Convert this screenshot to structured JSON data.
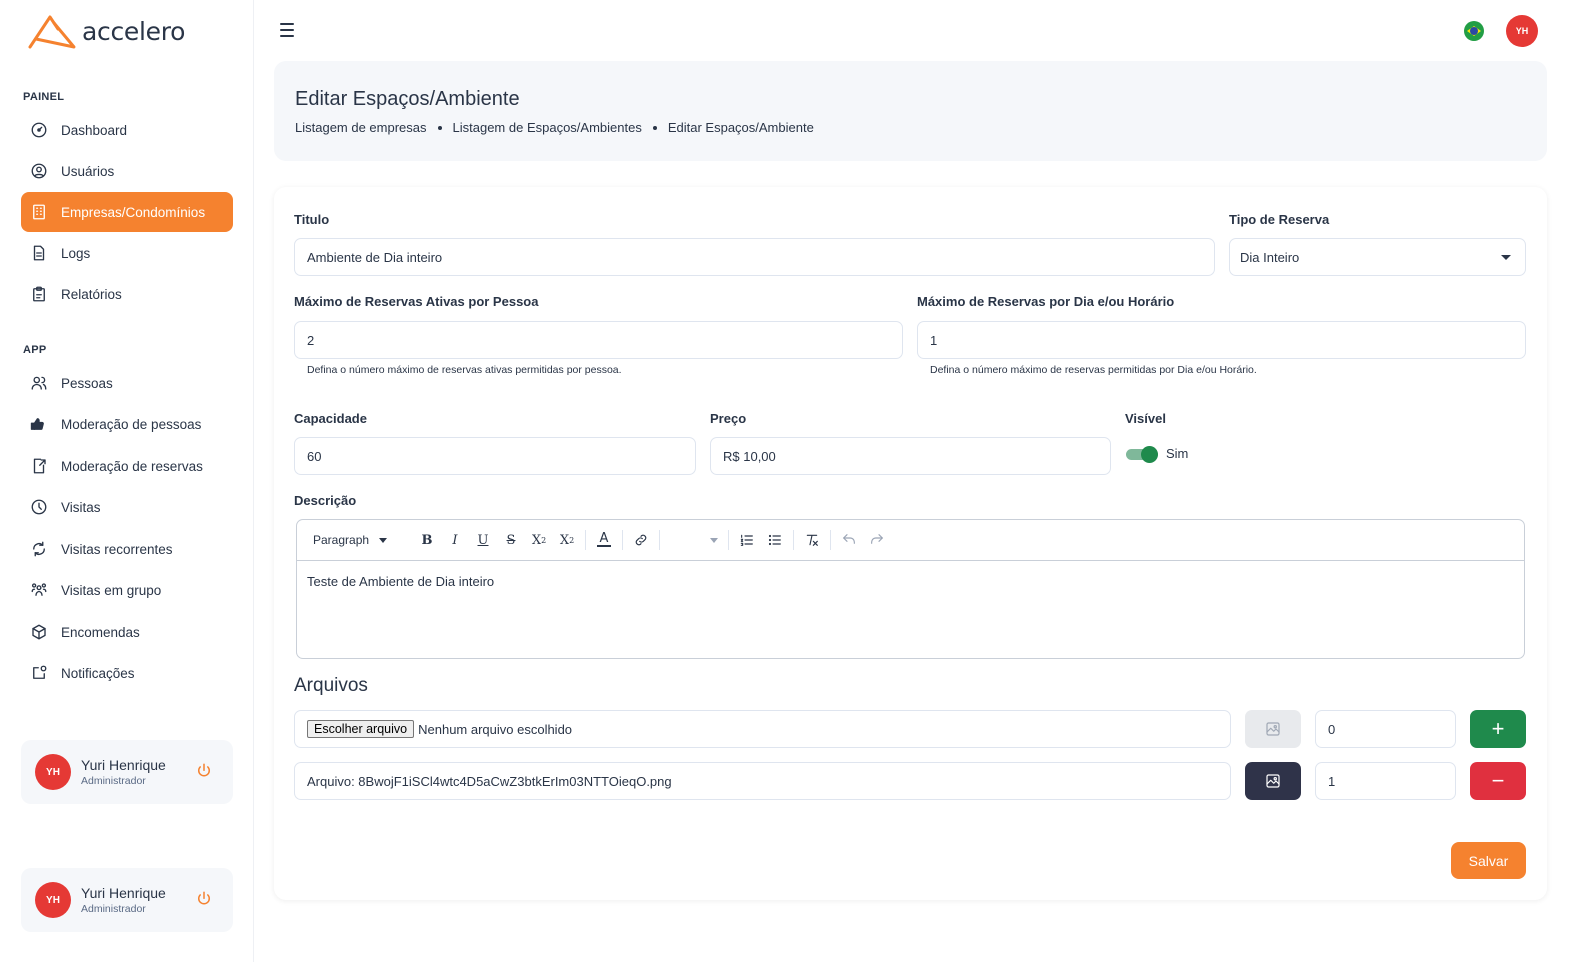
{
  "app": {
    "name": "accelero"
  },
  "sidebar": {
    "sections": [
      {
        "label": "PAINEL"
      },
      {
        "label": "APP"
      }
    ],
    "items": [
      {
        "label": "Dashboard",
        "icon": "dashboard-icon"
      },
      {
        "label": "Usuários",
        "icon": "user-circle-icon"
      },
      {
        "label": "Empresas/Condomínios",
        "icon": "building-icon",
        "active": true
      },
      {
        "label": "Logs",
        "icon": "file-icon"
      },
      {
        "label": "Relatórios",
        "icon": "clipboard-icon"
      },
      {
        "label": "Pessoas",
        "icon": "users-icon"
      },
      {
        "label": "Moderação de pessoas",
        "icon": "thumbs-icon"
      },
      {
        "label": "Moderação de reservas",
        "icon": "file-export-icon"
      },
      {
        "label": "Visitas",
        "icon": "clock-icon"
      },
      {
        "label": "Visitas recorrentes",
        "icon": "refresh-icon"
      },
      {
        "label": "Visitas em grupo",
        "icon": "group-icon"
      },
      {
        "label": "Encomendas",
        "icon": "package-icon"
      },
      {
        "label": "Notificações",
        "icon": "notification-icon"
      }
    ],
    "users": [
      {
        "initials": "YH",
        "name": "Yuri Henrique",
        "role": "Administrador"
      },
      {
        "initials": "YH",
        "name": "Yuri Henrique",
        "role": "Administrador"
      }
    ]
  },
  "topbar": {
    "avatar_initials": "YH",
    "language_icon": "brazil-flag-icon"
  },
  "header": {
    "title": "Editar Espaços/Ambiente",
    "breadcrumb": [
      "Listagem de empresas",
      "Listagem de Espaços/Ambientes",
      "Editar Espaços/Ambiente"
    ]
  },
  "form": {
    "titulo": {
      "label": "Titulo",
      "value": "Ambiente de Dia inteiro"
    },
    "tipo_reserva": {
      "label": "Tipo de Reserva",
      "value": "Dia Inteiro"
    },
    "max_ativas": {
      "label": "Máximo de Reservas Ativas por Pessoa",
      "value": "2",
      "hint": "Defina o número máximo de reservas ativas permitidas por pessoa."
    },
    "max_dia": {
      "label": "Máximo de Reservas por Dia e/ou Horário",
      "value": "1",
      "hint": "Defina o número máximo de reservas permitidas por Dia e/ou Horário."
    },
    "capacidade": {
      "label": "Capacidade",
      "value": "60"
    },
    "preco": {
      "label": "Preço",
      "value": "R$ 10,00"
    },
    "visivel": {
      "label": "Visível",
      "toggle_label": "Sim",
      "checked": true
    },
    "descricao": {
      "label": "Descrição",
      "block_format": "Paragraph",
      "content": "Teste de Ambiente de Dia inteiro"
    },
    "arquivos": {
      "title": "Arquivos",
      "rows": [
        {
          "choose_label": "Escolher arquivo",
          "status": "Nenhum arquivo escolhido",
          "order": "0",
          "action": "+"
        },
        {
          "file": "Arquivo: 8BwojF1iSCl4wtc4D5aCwZ3btkErIm03NTTOieqO.png",
          "order": "1",
          "action": "−"
        }
      ]
    },
    "save_label": "Salvar"
  },
  "colors": {
    "accent": "#f5822f",
    "success": "#1f8a4c",
    "danger": "#e0303f",
    "dark": "#2f3349"
  }
}
